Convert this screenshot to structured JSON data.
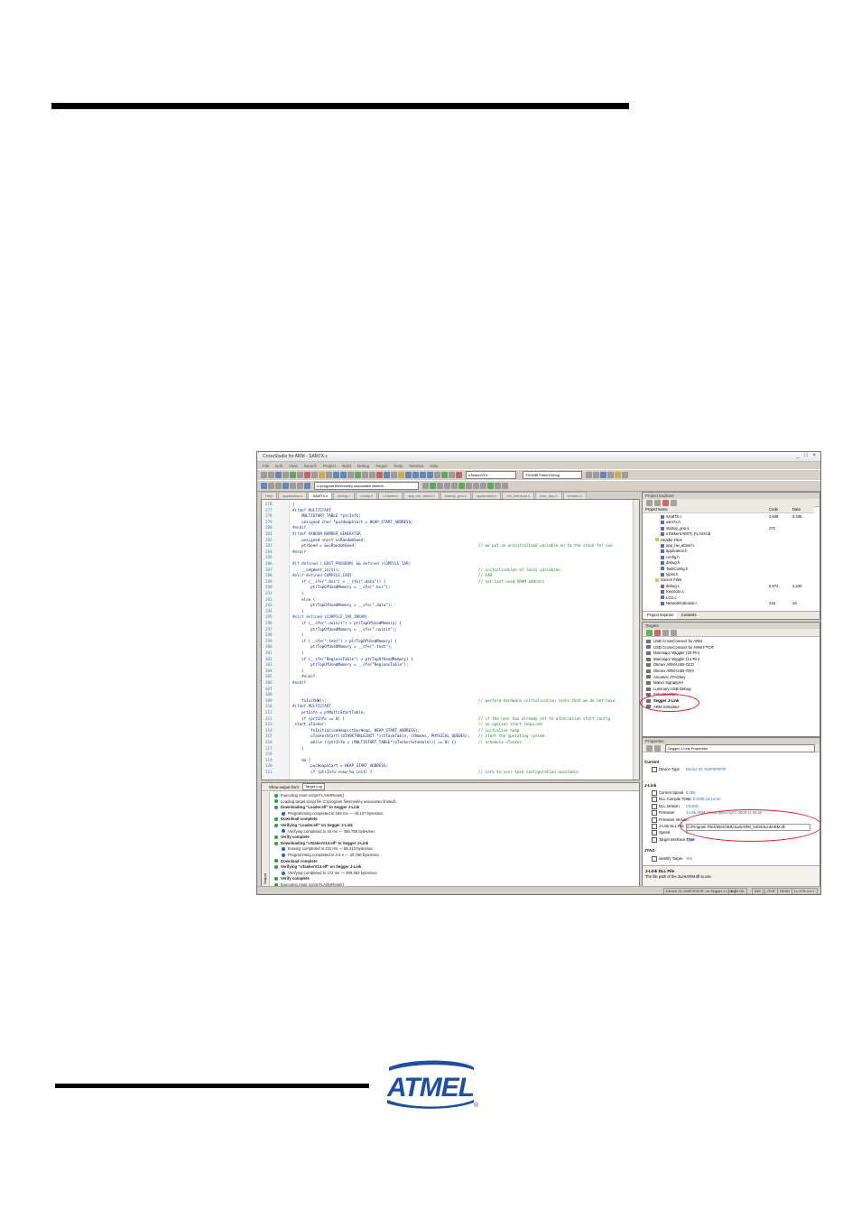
{
  "window": {
    "title": "CrossStudio for ARM - SAM7X.c",
    "controls": "_ □ ×",
    "menu": [
      "File",
      "Edit",
      "View",
      "Search",
      "Project",
      "Build",
      "Debug",
      "Target",
      "Tools",
      "Window",
      "Help"
    ],
    "path_field": "c:\\program files\\rowley associates limited\\...",
    "target_select": "uTaskerV13",
    "config_select": "THUMB Flash Debug"
  },
  "tabs": [
    "Help",
    "application.c",
    "SAM7X.c",
    "debug.c",
    "config.h",
    "uTasker.c",
    "app_hw_atmel.h",
    "startup_gnu.s",
    "application.h",
    "eth_interrupt.c",
    "mac_app.c",
    "version.h"
  ],
  "editor": {
    "lines": [
      {
        "n": "276",
        "t": "{",
        "k": "code"
      },
      {
        "n": "277",
        "t": "#ifdef MULTISTART",
        "k": "kw"
      },
      {
        "n": "278",
        "t": "    MULTISTART_TABLE *ptrInfo;",
        "k": "code"
      },
      {
        "n": "279",
        "t": "    unsigned char *pucHeapStart = HEAP_START_ADDRESS;",
        "k": "code"
      },
      {
        "n": "280",
        "t": "#endif",
        "k": "kw"
      },
      {
        "n": "281",
        "t": "#ifdef RANDOM_NUMBER_GENERATOR",
        "k": "kw"
      },
      {
        "n": "282",
        "t": "    unsigned short usRandomSeed;",
        "k": "code"
      },
      {
        "n": "283",
        "t": "    ptrSeed = &usRandomSeed;",
        "k": "code"
      },
      {
        "n": "284",
        "t": "#endif",
        "k": "kw"
      },
      {
        "n": "285",
        "t": "",
        "k": "code"
      },
      {
        "n": "286",
        "t": "#if defined (_BOOT_PROGRAM) && defined (COMPILE_IAR)",
        "k": "kw"
      },
      {
        "n": "287",
        "t": "    __segment_init();",
        "k": "code"
      },
      {
        "n": "288",
        "t": "#elif defined COMPILE_IAR5",
        "k": "kw"
      },
      {
        "n": "289",
        "t": "    if (__sfe(\".bss\") > __sfe(\".data\")) {",
        "k": "code"
      },
      {
        "n": "290",
        "t": "        ptrTopOfUsedMemory = __sfe(\".bss\");",
        "k": "code"
      },
      {
        "n": "291",
        "t": "    }",
        "k": "code"
      },
      {
        "n": "292",
        "t": "    else {",
        "k": "code"
      },
      {
        "n": "293",
        "t": "        ptrTopOfUsedMemory = __sfe(\".data\");",
        "k": "code"
      },
      {
        "n": "294",
        "t": "    }",
        "k": "code"
      },
      {
        "n": "295",
        "t": "#elif defined (COMPILE_IAR_INRAM)",
        "k": "kw"
      },
      {
        "n": "296",
        "t": "    if (__sfe(\".noinit\") > ptrTopOfUsedMemory) {",
        "k": "code"
      },
      {
        "n": "297",
        "t": "        ptrTopOfUsedMemory = __sfe(\".noinit\");",
        "k": "code"
      },
      {
        "n": "298",
        "t": "    }",
        "k": "code"
      },
      {
        "n": "299",
        "t": "    if (__sfe(\".text\") > ptrTopOfUsedMemory) {",
        "k": "code"
      },
      {
        "n": "300",
        "t": "        ptrTopOfUsedMemory = __sfe(\".text\");",
        "k": "code"
      },
      {
        "n": "301",
        "t": "    }",
        "k": "code"
      },
      {
        "n": "302",
        "t": "    if (__sfe(\"RegionsTable\") > ptrTopOfUsedMemory) {",
        "k": "code"
      },
      {
        "n": "303",
        "t": "        ptrTopOfUsedMemory = __sfe(\"RegionsTable\");",
        "k": "code"
      },
      {
        "n": "304",
        "t": "    }",
        "k": "code"
      },
      {
        "n": "305",
        "t": "    #endif",
        "k": "kw"
      },
      {
        "n": "306",
        "t": "#endif",
        "k": "kw"
      },
      {
        "n": "307",
        "t": "",
        "k": "code"
      },
      {
        "n": "308",
        "t": "",
        "k": "code"
      },
      {
        "n": "309",
        "t": "    fnInitHW();",
        "k": "code"
      },
      {
        "n": "310",
        "t": "#ifdef MULTISTART",
        "k": "kw"
      },
      {
        "n": "311",
        "t": "    prtInfo = ptMultiStartTable;",
        "k": "code"
      },
      {
        "n": "312",
        "t": "    if (prtInfo == 0) {",
        "k": "code"
      },
      {
        "n": "313",
        "t": "_start_uTasker:",
        "k": "code"
      },
      {
        "n": "314",
        "t": "        fnInitialiseHeap(ctOurHeap, HEAP_START_ADDRESS);",
        "k": "code"
      },
      {
        "n": "315",
        "t": "        uTaskerStart((UTASKTABLEINIT *)ctTaskTable, ctNodes, PHYSICAL_QUEUES);",
        "k": "code"
      },
      {
        "n": "316",
        "t": "        while ((ptrInfo = (MULTISTART_TABLE*)uTaskerSchedule()) == 0) {}",
        "k": "code"
      },
      {
        "n": "317",
        "t": "    }",
        "k": "code"
      },
      {
        "n": "318",
        "t": "",
        "k": "code"
      },
      {
        "n": "319",
        "t": "    do {",
        "k": "code"
      },
      {
        "n": "320",
        "t": "        pucHeapStart = HEAP_START_ADDRESS;",
        "k": "code"
      },
      {
        "n": "321",
        "t": "        if (ptrInfo->new_hw_init) {",
        "k": "code"
      }
    ],
    "comments": [
      {
        "row": 7,
        "t": "// we put an uninitialised variable on to the stack for use"
      },
      {
        "row": 11,
        "t": "// initialisation of local variables"
      },
      {
        "row": 12,
        "t": "// FAR"
      },
      {
        "row": 13,
        "t": "// set last used SRAM address"
      },
      {
        "row": 33,
        "t": "// perform hardware initialisation (note that we do not have"
      },
      {
        "row": 36,
        "t": "// if the user has already set to alternative start config"
      },
      {
        "row": 37,
        "t": "// no special start required"
      },
      {
        "row": 38,
        "t": "// initialise heap"
      },
      {
        "row": 39,
        "t": "// start the operating system"
      },
      {
        "row": 40,
        "t": "// schedule uTasker"
      },
      {
        "row": 45,
        "t": "// info to user task configuration available"
      }
    ]
  },
  "output": {
    "header": "Show output from:",
    "source": "Target Log",
    "side_label": "Output",
    "lines": [
      {
        "t": "Executing reset script FLASHReset()",
        "b": false,
        "i": "g"
      },
      {
        "t": "Loading target script file C:/program files/rowley associates limited/...",
        "b": false,
        "i": "g"
      },
      {
        "t": "Downloading \"Loader.elf\" to Segger J-Link",
        "b": true,
        "i": "g"
      },
      {
        "t": "Programming completed in 169 ms — 45,137 bytes/sec",
        "b": false,
        "i": "b"
      },
      {
        "t": "Download complete",
        "b": true,
        "i": "g"
      },
      {
        "t": "Verifying \"Loader.elf\" on Segger J-Link",
        "b": true,
        "i": "g"
      },
      {
        "t": "Verifying completed in 16 ms — 356,750 bytes/sec",
        "b": false,
        "i": "b"
      },
      {
        "t": "Verify complete",
        "b": true,
        "i": "g"
      },
      {
        "t": "Downloading \"uTaskerV13.elf\" to Segger J-Link",
        "b": true,
        "i": "g"
      },
      {
        "t": "Erasing completed in 211 ms — 68,413 bytes/sec",
        "b": false,
        "i": "b"
      },
      {
        "t": "Programming completed in 2.5 s — 32,756 bytes/sec",
        "b": false,
        "i": "b"
      },
      {
        "t": "Download complete",
        "b": true,
        "i": "g"
      },
      {
        "t": "Verifying \"uTaskerV13.elf\" on Segger J-Link",
        "b": true,
        "i": "g"
      },
      {
        "t": "Verifying completed in 172 ms — 490,353 bytes/sec",
        "b": false,
        "i": "b"
      },
      {
        "t": "Verify complete",
        "b": true,
        "i": "g"
      },
      {
        "t": "Executing reset script FLASHReset()",
        "b": false,
        "i": "g"
      }
    ]
  },
  "project_explorer": {
    "title": "Project Explorer",
    "cols": [
      "Project Items",
      "Code",
      "Data"
    ],
    "items": [
      {
        "n": "SAM7X.c",
        "c": "3,548",
        "d": "2,336",
        "ind": 12,
        "f": false
      },
      {
        "n": "sam7x.h",
        "c": "",
        "d": "",
        "ind": 12,
        "f": false
      },
      {
        "n": "startup_gnu.s",
        "c": "272",
        "d": "",
        "ind": 12,
        "f": false
      },
      {
        "n": "uTaskerSAM7X_FLASH.ld",
        "c": "",
        "d": "",
        "ind": 12,
        "f": false
      },
      {
        "n": "Header Files",
        "c": "",
        "d": "",
        "ind": 6,
        "f": true
      },
      {
        "n": "app_hw_atmel.h",
        "c": "",
        "d": "",
        "ind": 12,
        "f": false
      },
      {
        "n": "application.h",
        "c": "",
        "d": "",
        "ind": 12,
        "f": false
      },
      {
        "n": "config.h",
        "c": "",
        "d": "",
        "ind": 12,
        "f": false
      },
      {
        "n": "debug.h",
        "c": "",
        "d": "",
        "ind": 12,
        "f": false
      },
      {
        "n": "TaskConfig.h",
        "c": "",
        "d": "",
        "ind": 12,
        "f": false
      },
      {
        "n": "types.h",
        "c": "",
        "d": "",
        "ind": 12,
        "f": false
      },
      {
        "n": "Source Files",
        "c": "",
        "d": "",
        "ind": 6,
        "f": true
      },
      {
        "n": "debug.c",
        "c": "5,572",
        "d": "2,240",
        "ind": 12,
        "f": false
      },
      {
        "n": "KeyScan.c",
        "c": "",
        "d": "",
        "ind": 12,
        "f": false
      },
      {
        "n": "LCD.c",
        "c": "",
        "d": "",
        "ind": 12,
        "f": false
      },
      {
        "n": "NetworkIndicator.c",
        "c": "216",
        "d": "16",
        "ind": 12,
        "f": false
      }
    ],
    "bottom_tabs": [
      "Project Explorer",
      "Contents"
    ]
  },
  "targets": {
    "title": "Targets",
    "items": [
      {
        "n": "USB CrossConnect for ARM",
        "b": false
      },
      {
        "n": "USB CrossConnect for ARM FTCR",
        "b": false
      },
      {
        "n": "Macraigor Wiggler (20 Pin)",
        "b": false
      },
      {
        "n": "Macraigor Wiggler (14 Pin)",
        "b": false
      },
      {
        "n": "Olimex ARM-USB-OCD",
        "b": false
      },
      {
        "n": "Olimex ARM-USB-TINY",
        "b": false
      },
      {
        "n": "Amontec JTAGkey",
        "b": false
      },
      {
        "n": "Marvo Signalyzer",
        "b": false
      },
      {
        "n": "Luminary USB Debug",
        "b": false
      },
      {
        "n": "Simulator/Sim",
        "b": false
      },
      {
        "n": "Segger J-Link",
        "b": true
      },
      {
        "n": "ARM Simulator",
        "b": false
      }
    ]
  },
  "properties": {
    "title": "Properties",
    "selector": "Segger J-Link Properties",
    "sect_current": "Current",
    "device_type_label": "Device Type",
    "device_type_value": "Device ID: 0x3F0F0F0F",
    "sect_jlink": "J-Link",
    "rows": [
      {
        "k": "Current Speed",
        "v": "8,000"
      },
      {
        "k": "DLL Compile Time",
        "v": "Apr 9 2008 15:14:52"
      },
      {
        "k": "DLL Version",
        "v": "V3.80d"
      },
      {
        "k": "Firmware",
        "v": "J-Link ARM V6 compiled Apr 1 2008 11:09:40"
      },
      {
        "k": "Firmware Version",
        "v": ""
      },
      {
        "k": "J-Link DLL File",
        "v": "C:/Program Files/SEGGER/JLinkARM_V404/JLinkARM.dll"
      },
      {
        "k": "Speed",
        "v": "8"
      },
      {
        "k": "Target Interface Type",
        "v": "JTAG"
      }
    ],
    "sect_jtag": "JTAG",
    "identify_label": "Identify Target",
    "identify_value": "Yes",
    "desc_title": "J-Link DLL File",
    "desc_text": "The file path of the JLinkARM.dll to use."
  },
  "statusbar": {
    "device": "Device ID: 0x3F0F0F0F on Segger J-Link",
    "build": "Built OK",
    "ins": "INS",
    "ovr": "OVR",
    "read": "READ",
    "pos": "Ln 276 Col 1"
  },
  "colors": {
    "logo_blue": "#1f4f9f",
    "highlight_red": "#e02020"
  },
  "logo": {
    "text": "ATMEL",
    "mark": "®"
  }
}
